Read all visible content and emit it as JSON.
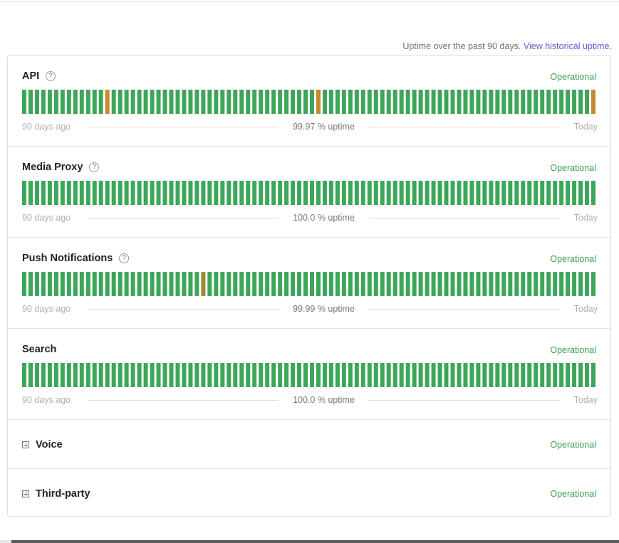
{
  "header": {
    "uptime_note": "Uptime over the past 90 days.",
    "historical_link": "View historical uptime."
  },
  "colors": {
    "operational": "#3e9e51",
    "bar_green": "#3ea65a",
    "bar_orange": "#c88a2e",
    "bar_olive": "#9a8c32",
    "link": "#5b5fd6"
  },
  "components": [
    {
      "name": "API",
      "has_help": true,
      "status": "Operational",
      "start_label": "90 days ago",
      "uptime": "99.97 % uptime",
      "end_label": "Today",
      "incident_days": {
        "13": "orange",
        "46": "orange",
        "89": "orange"
      }
    },
    {
      "name": "Media Proxy",
      "has_help": true,
      "status": "Operational",
      "start_label": "90 days ago",
      "uptime": "100.0 % uptime",
      "end_label": "Today",
      "incident_days": {}
    },
    {
      "name": "Push Notifications",
      "has_help": true,
      "status": "Operational",
      "start_label": "90 days ago",
      "uptime": "99.99 % uptime",
      "end_label": "Today",
      "incident_days": {
        "28": "olive"
      }
    },
    {
      "name": "Search",
      "has_help": false,
      "status": "Operational",
      "start_label": "90 days ago",
      "uptime": "100.0 % uptime",
      "end_label": "Today",
      "incident_days": {}
    }
  ],
  "groups": [
    {
      "name": "Voice",
      "status": "Operational"
    },
    {
      "name": "Third-party",
      "status": "Operational"
    }
  ],
  "help_glyph": "?",
  "icons": {
    "help": "question-circle-icon",
    "expand": "plus-square-icon"
  }
}
